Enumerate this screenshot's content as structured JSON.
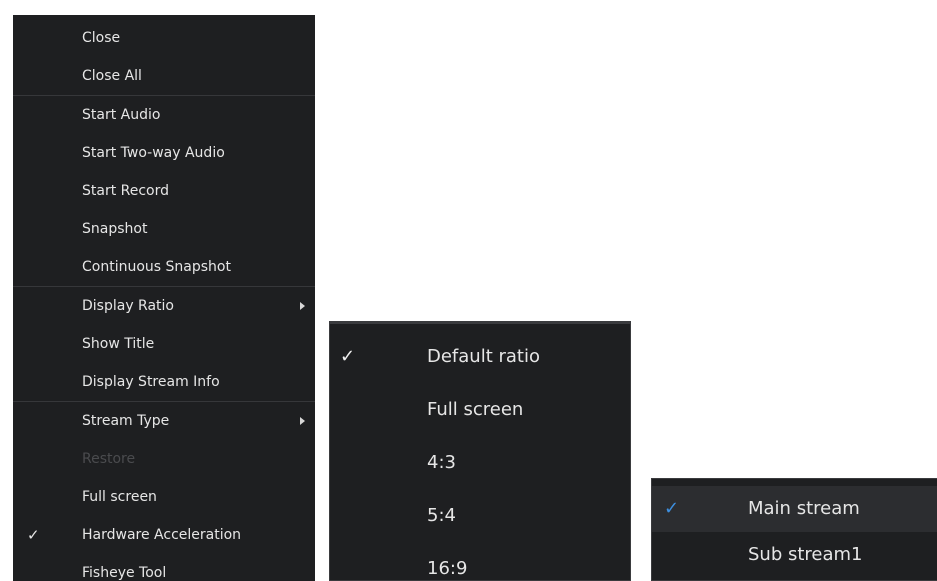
{
  "main_menu": {
    "items": [
      {
        "label": "Close"
      },
      {
        "label": "Close All"
      },
      {
        "label": "Start Audio"
      },
      {
        "label": "Start Two-way Audio"
      },
      {
        "label": "Start Record"
      },
      {
        "label": "Snapshot"
      },
      {
        "label": "Continuous Snapshot"
      },
      {
        "label": "Display Ratio"
      },
      {
        "label": "Show Title"
      },
      {
        "label": "Display Stream Info"
      },
      {
        "label": "Stream Type"
      },
      {
        "label": "Restore"
      },
      {
        "label": "Full screen"
      },
      {
        "label": "Hardware Acceleration"
      },
      {
        "label": "Fisheye Tool"
      }
    ],
    "checkmark": "✓"
  },
  "ratio_menu": {
    "items": [
      {
        "label": "Default ratio"
      },
      {
        "label": "Full screen"
      },
      {
        "label": "4:3"
      },
      {
        "label": "5:4"
      },
      {
        "label": "16:9"
      }
    ],
    "checkmark": "✓"
  },
  "stream_menu": {
    "items": [
      {
        "label": "Main stream"
      },
      {
        "label": "Sub stream1"
      }
    ],
    "checkmark": "✓",
    "check_color": "#3d8fe0"
  },
  "colors": {
    "menu_bg": "#1e1f21",
    "text": "#e6e6e6",
    "disabled_text": "#4a4b4e",
    "separator": "#36373a"
  }
}
